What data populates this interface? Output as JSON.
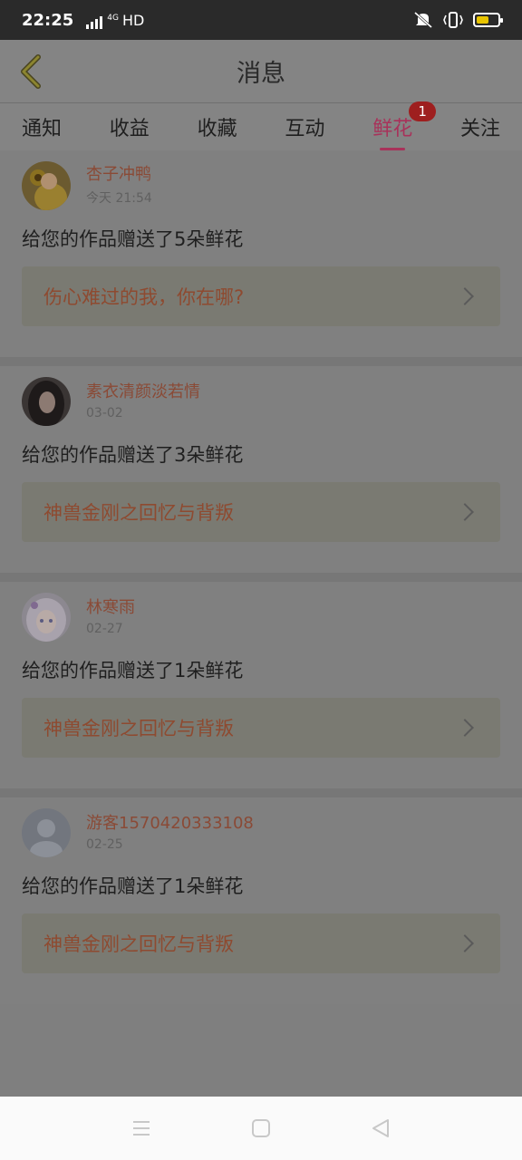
{
  "status": {
    "time": "22:25",
    "network": "4G",
    "hd": "HD"
  },
  "header": {
    "title": "消息"
  },
  "tabs": [
    {
      "label": "通知"
    },
    {
      "label": "收益"
    },
    {
      "label": "收藏"
    },
    {
      "label": "互动"
    },
    {
      "label": "鲜花",
      "badge": "1",
      "active": true
    },
    {
      "label": "关注"
    }
  ],
  "messages": [
    {
      "user": "杏子冲鸭",
      "time": "今天 21:54",
      "text": "给您的作品赠送了5朵鲜花",
      "work": "伤心难过的我，你在哪?",
      "avatar_icon": "sunflower-avatar"
    },
    {
      "user": "素衣清颜淡若情",
      "time": "03-02",
      "text": "给您的作品赠送了3朵鲜花",
      "work": "神兽金刚之回忆与背叛",
      "avatar_icon": "girl-avatar"
    },
    {
      "user": "林寒雨",
      "time": "02-27",
      "text": "给您的作品赠送了1朵鲜花",
      "work": "神兽金刚之回忆与背叛",
      "avatar_icon": "anime-avatar"
    },
    {
      "user": "游客1570420333108",
      "time": "02-25",
      "text": "给您的作品赠送了1朵鲜花",
      "work": "神兽金刚之回忆与背叛",
      "avatar_icon": "default-avatar"
    }
  ],
  "colors": {
    "accent": "#a8325a",
    "username": "#8a4a36",
    "badge": "#9e1f1f"
  }
}
